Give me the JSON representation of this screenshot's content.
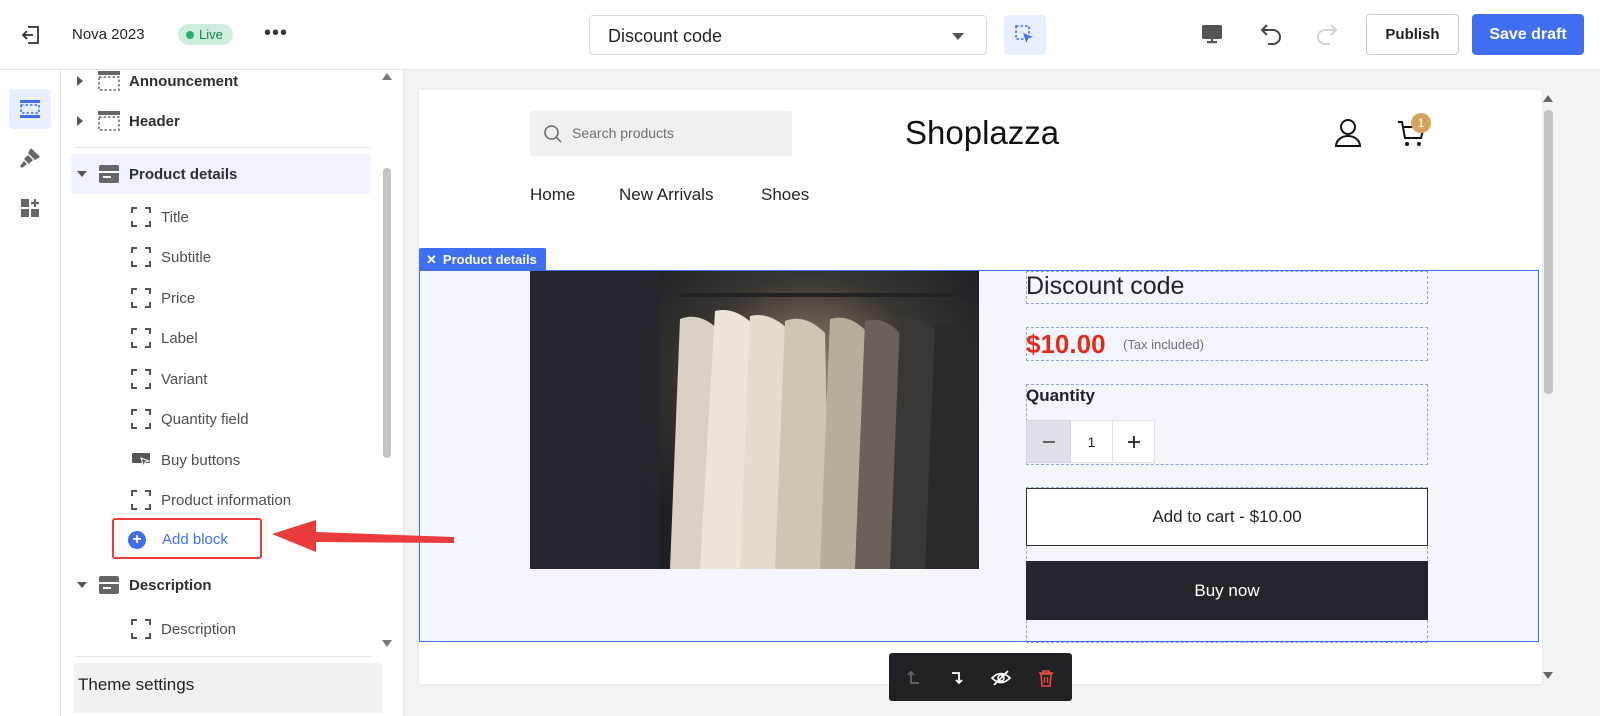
{
  "topbar": {
    "store_name": "Nova 2023",
    "live_badge": "Live",
    "more_icon": "more-horizontal-icon",
    "page_selector_value": "Discount code",
    "publish_label": "Publish",
    "save_draft_label": "Save draft"
  },
  "sidebar": {
    "sections": {
      "announcement": "Announcement",
      "header": "Header",
      "product_details": "Product details",
      "description": "Description"
    },
    "blocks": [
      {
        "label": "Title"
      },
      {
        "label": "Subtitle"
      },
      {
        "label": "Price"
      },
      {
        "label": "Label"
      },
      {
        "label": "Variant"
      },
      {
        "label": "Quantity field"
      },
      {
        "label": "Buy buttons"
      },
      {
        "label": "Product information"
      }
    ],
    "add_block_label": "Add block",
    "description_block": "Description",
    "theme_settings_label": "Theme settings"
  },
  "preview": {
    "search_placeholder": "Search products",
    "brand": "Shoplazza",
    "cart_count": "1",
    "nav": [
      "Home",
      "New Arrivals",
      "Shoes"
    ],
    "section_tag": "Product details",
    "product_title": "Discount code",
    "price": "$10.00",
    "tax_note": "(Tax included)",
    "quantity_label": "Quantity",
    "quantity_value": "1",
    "add_to_cart": "Add to cart  -  $10.00",
    "buy_now": "Buy now"
  },
  "colors": {
    "accent": "#3f6ff0",
    "price": "#e02d1b",
    "live_bg": "#cdeedd",
    "annotation": "#ea3c3c",
    "buy_now_bg": "#23262d"
  }
}
